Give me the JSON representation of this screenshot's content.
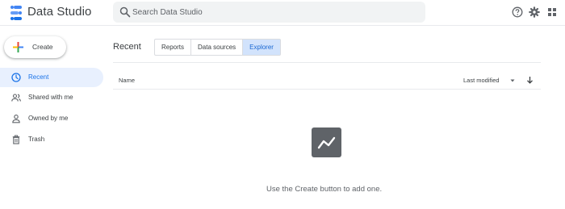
{
  "app": {
    "title": "Data Studio"
  },
  "search": {
    "placeholder": "Search Data Studio"
  },
  "header_icons": [
    "help-icon",
    "settings-icon",
    "apps-grid-icon"
  ],
  "sidebar": {
    "create_label": "Create",
    "items": [
      {
        "label": "Recent",
        "icon": "clock-icon",
        "active": true
      },
      {
        "label": "Shared with me",
        "icon": "people-icon",
        "active": false
      },
      {
        "label": "Owned by me",
        "icon": "person-icon",
        "active": false
      },
      {
        "label": "Trash",
        "icon": "trash-icon",
        "active": false
      }
    ]
  },
  "main": {
    "title": "Recent",
    "tabs": [
      {
        "label": "Reports",
        "active": false
      },
      {
        "label": "Data sources",
        "active": false
      },
      {
        "label": "Explorer",
        "active": true
      }
    ],
    "list": {
      "name_header": "Name",
      "sort_label": "Last modified"
    },
    "empty_message": "Use the Create button to add one."
  },
  "colors": {
    "accent": "#1a73e8",
    "active_bg": "#e8f0fe",
    "active_tab_bg": "#d2e3fc",
    "empty_icon_bg": "#5f6368"
  }
}
